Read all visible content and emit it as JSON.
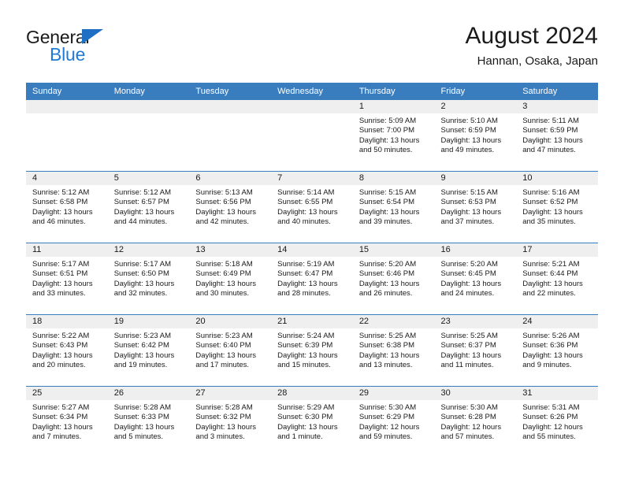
{
  "logo": {
    "word_top": "General",
    "word_bottom": "Blue",
    "triangle_color": "#1f6fc4",
    "text_color": "#1f7bd4"
  },
  "header": {
    "title": "August 2024",
    "subtitle": "Hannan, Osaka, Japan"
  },
  "theme": {
    "header_band": "#3a7dbf",
    "daynum_band": "#efefef",
    "grid_line": "#3a7dbf",
    "text": "#1a1a1a"
  },
  "weekday_headers": [
    "Sunday",
    "Monday",
    "Tuesday",
    "Wednesday",
    "Thursday",
    "Friday",
    "Saturday"
  ],
  "labels": {
    "sunrise": "Sunrise:",
    "sunset": "Sunset:",
    "daylight": "Daylight:"
  },
  "weeks": [
    [
      {
        "day": "",
        "empty": true
      },
      {
        "day": "",
        "empty": true
      },
      {
        "day": "",
        "empty": true
      },
      {
        "day": "",
        "empty": true
      },
      {
        "day": "1",
        "sunrise": "Sunrise: 5:09 AM",
        "sunset": "Sunset: 7:00 PM",
        "daylight_1": "Daylight: 13 hours",
        "daylight_2": "and 50 minutes."
      },
      {
        "day": "2",
        "sunrise": "Sunrise: 5:10 AM",
        "sunset": "Sunset: 6:59 PM",
        "daylight_1": "Daylight: 13 hours",
        "daylight_2": "and 49 minutes."
      },
      {
        "day": "3",
        "sunrise": "Sunrise: 5:11 AM",
        "sunset": "Sunset: 6:59 PM",
        "daylight_1": "Daylight: 13 hours",
        "daylight_2": "and 47 minutes."
      }
    ],
    [
      {
        "day": "4",
        "sunrise": "Sunrise: 5:12 AM",
        "sunset": "Sunset: 6:58 PM",
        "daylight_1": "Daylight: 13 hours",
        "daylight_2": "and 46 minutes."
      },
      {
        "day": "5",
        "sunrise": "Sunrise: 5:12 AM",
        "sunset": "Sunset: 6:57 PM",
        "daylight_1": "Daylight: 13 hours",
        "daylight_2": "and 44 minutes."
      },
      {
        "day": "6",
        "sunrise": "Sunrise: 5:13 AM",
        "sunset": "Sunset: 6:56 PM",
        "daylight_1": "Daylight: 13 hours",
        "daylight_2": "and 42 minutes."
      },
      {
        "day": "7",
        "sunrise": "Sunrise: 5:14 AM",
        "sunset": "Sunset: 6:55 PM",
        "daylight_1": "Daylight: 13 hours",
        "daylight_2": "and 40 minutes."
      },
      {
        "day": "8",
        "sunrise": "Sunrise: 5:15 AM",
        "sunset": "Sunset: 6:54 PM",
        "daylight_1": "Daylight: 13 hours",
        "daylight_2": "and 39 minutes."
      },
      {
        "day": "9",
        "sunrise": "Sunrise: 5:15 AM",
        "sunset": "Sunset: 6:53 PM",
        "daylight_1": "Daylight: 13 hours",
        "daylight_2": "and 37 minutes."
      },
      {
        "day": "10",
        "sunrise": "Sunrise: 5:16 AM",
        "sunset": "Sunset: 6:52 PM",
        "daylight_1": "Daylight: 13 hours",
        "daylight_2": "and 35 minutes."
      }
    ],
    [
      {
        "day": "11",
        "sunrise": "Sunrise: 5:17 AM",
        "sunset": "Sunset: 6:51 PM",
        "daylight_1": "Daylight: 13 hours",
        "daylight_2": "and 33 minutes."
      },
      {
        "day": "12",
        "sunrise": "Sunrise: 5:17 AM",
        "sunset": "Sunset: 6:50 PM",
        "daylight_1": "Daylight: 13 hours",
        "daylight_2": "and 32 minutes."
      },
      {
        "day": "13",
        "sunrise": "Sunrise: 5:18 AM",
        "sunset": "Sunset: 6:49 PM",
        "daylight_1": "Daylight: 13 hours",
        "daylight_2": "and 30 minutes."
      },
      {
        "day": "14",
        "sunrise": "Sunrise: 5:19 AM",
        "sunset": "Sunset: 6:47 PM",
        "daylight_1": "Daylight: 13 hours",
        "daylight_2": "and 28 minutes."
      },
      {
        "day": "15",
        "sunrise": "Sunrise: 5:20 AM",
        "sunset": "Sunset: 6:46 PM",
        "daylight_1": "Daylight: 13 hours",
        "daylight_2": "and 26 minutes."
      },
      {
        "day": "16",
        "sunrise": "Sunrise: 5:20 AM",
        "sunset": "Sunset: 6:45 PM",
        "daylight_1": "Daylight: 13 hours",
        "daylight_2": "and 24 minutes."
      },
      {
        "day": "17",
        "sunrise": "Sunrise: 5:21 AM",
        "sunset": "Sunset: 6:44 PM",
        "daylight_1": "Daylight: 13 hours",
        "daylight_2": "and 22 minutes."
      }
    ],
    [
      {
        "day": "18",
        "sunrise": "Sunrise: 5:22 AM",
        "sunset": "Sunset: 6:43 PM",
        "daylight_1": "Daylight: 13 hours",
        "daylight_2": "and 20 minutes."
      },
      {
        "day": "19",
        "sunrise": "Sunrise: 5:23 AM",
        "sunset": "Sunset: 6:42 PM",
        "daylight_1": "Daylight: 13 hours",
        "daylight_2": "and 19 minutes."
      },
      {
        "day": "20",
        "sunrise": "Sunrise: 5:23 AM",
        "sunset": "Sunset: 6:40 PM",
        "daylight_1": "Daylight: 13 hours",
        "daylight_2": "and 17 minutes."
      },
      {
        "day": "21",
        "sunrise": "Sunrise: 5:24 AM",
        "sunset": "Sunset: 6:39 PM",
        "daylight_1": "Daylight: 13 hours",
        "daylight_2": "and 15 minutes."
      },
      {
        "day": "22",
        "sunrise": "Sunrise: 5:25 AM",
        "sunset": "Sunset: 6:38 PM",
        "daylight_1": "Daylight: 13 hours",
        "daylight_2": "and 13 minutes."
      },
      {
        "day": "23",
        "sunrise": "Sunrise: 5:25 AM",
        "sunset": "Sunset: 6:37 PM",
        "daylight_1": "Daylight: 13 hours",
        "daylight_2": "and 11 minutes."
      },
      {
        "day": "24",
        "sunrise": "Sunrise: 5:26 AM",
        "sunset": "Sunset: 6:36 PM",
        "daylight_1": "Daylight: 13 hours",
        "daylight_2": "and 9 minutes."
      }
    ],
    [
      {
        "day": "25",
        "sunrise": "Sunrise: 5:27 AM",
        "sunset": "Sunset: 6:34 PM",
        "daylight_1": "Daylight: 13 hours",
        "daylight_2": "and 7 minutes."
      },
      {
        "day": "26",
        "sunrise": "Sunrise: 5:28 AM",
        "sunset": "Sunset: 6:33 PM",
        "daylight_1": "Daylight: 13 hours",
        "daylight_2": "and 5 minutes."
      },
      {
        "day": "27",
        "sunrise": "Sunrise: 5:28 AM",
        "sunset": "Sunset: 6:32 PM",
        "daylight_1": "Daylight: 13 hours",
        "daylight_2": "and 3 minutes."
      },
      {
        "day": "28",
        "sunrise": "Sunrise: 5:29 AM",
        "sunset": "Sunset: 6:30 PM",
        "daylight_1": "Daylight: 13 hours",
        "daylight_2": "and 1 minute."
      },
      {
        "day": "29",
        "sunrise": "Sunrise: 5:30 AM",
        "sunset": "Sunset: 6:29 PM",
        "daylight_1": "Daylight: 12 hours",
        "daylight_2": "and 59 minutes."
      },
      {
        "day": "30",
        "sunrise": "Sunrise: 5:30 AM",
        "sunset": "Sunset: 6:28 PM",
        "daylight_1": "Daylight: 12 hours",
        "daylight_2": "and 57 minutes."
      },
      {
        "day": "31",
        "sunrise": "Sunrise: 5:31 AM",
        "sunset": "Sunset: 6:26 PM",
        "daylight_1": "Daylight: 12 hours",
        "daylight_2": "and 55 minutes."
      }
    ]
  ]
}
